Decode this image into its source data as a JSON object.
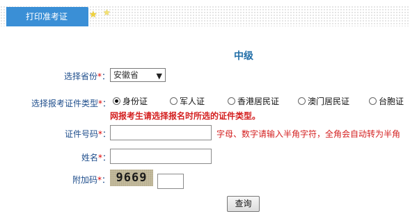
{
  "tab": {
    "label": "打印准考证"
  },
  "level_title": "中级",
  "form": {
    "province_label": "选择省份",
    "province_value": "安徽省",
    "id_type_label": "选择报考证件类型",
    "id_type_options": [
      "身份证",
      "军人证",
      "香港居民证",
      "澳门居民证",
      "台胞证"
    ],
    "id_type_selected": "身份证",
    "id_type_warning": "网报考生请选择报名时所选的证件类型。",
    "id_number_label": "证件号码",
    "id_number_value": "",
    "id_number_hint": "字母、数字请输入半角字符，全角会自动转为半角",
    "name_label": "姓名",
    "name_value": "",
    "captcha_label": "附加码",
    "captcha_text": "9669",
    "captcha_value": "",
    "required_mark": "*",
    "colon": "："
  },
  "submit": {
    "label": "查询"
  },
  "colors": {
    "tab_bg": "#3a8fd6",
    "label": "#1f4e8c",
    "warning": "#d42020",
    "title": "#236fa8"
  }
}
